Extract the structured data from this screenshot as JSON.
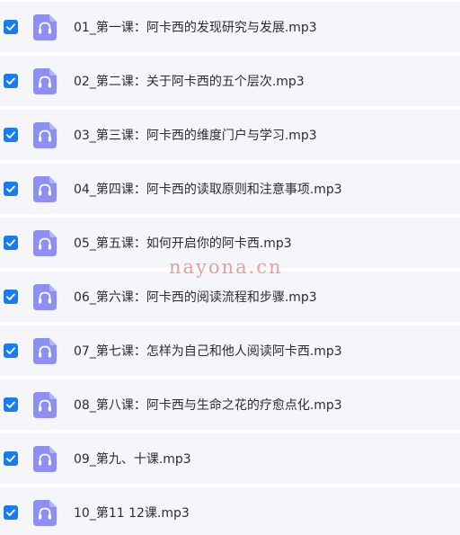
{
  "files": [
    {
      "name": "01_第一课：阿卡西的发现研究与发展.mp3",
      "checked": true
    },
    {
      "name": "02_第二课：关于阿卡西的五个层次.mp3",
      "checked": true
    },
    {
      "name": "03_第三课：阿卡西的维度门户与学习.mp3",
      "checked": true
    },
    {
      "name": "04_第四课：阿卡西的读取原则和注意事项.mp3",
      "checked": true
    },
    {
      "name": "05_第五课：如何开启你的阿卡西.mp3",
      "checked": true
    },
    {
      "name": "06_第六课：阿卡西的阅读流程和步骤.mp3",
      "checked": true
    },
    {
      "name": "07_第七课：怎样为自己和他人阅读阿卡西.mp3",
      "checked": true
    },
    {
      "name": "08_第八课：阿卡西与生命之花的疗愈点化.mp3",
      "checked": true
    },
    {
      "name": "09_第九、十课.mp3",
      "checked": true
    },
    {
      "name": "10_第11 12课.mp3",
      "checked": true
    }
  ],
  "icons": {
    "checkbox": "checkmark-icon",
    "file": "audio-file-headphones-icon"
  },
  "colors": {
    "checkbox": "#1a7cf0",
    "file_icon": "#8d8ff5",
    "row_bg": "#f5f6fa",
    "watermark": "#f08a8a"
  },
  "watermark": {
    "text": "nayona.cn"
  }
}
